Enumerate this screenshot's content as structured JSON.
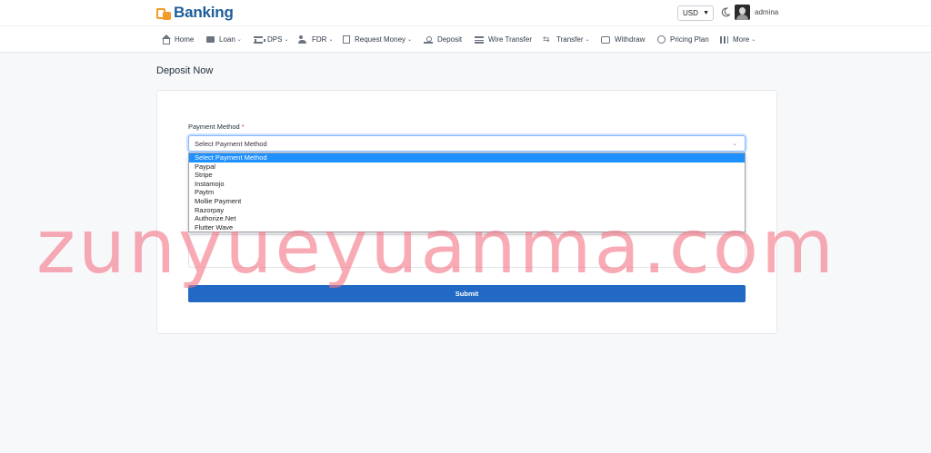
{
  "header": {
    "logo_text": "Banking",
    "currency": "USD",
    "username": "admina"
  },
  "nav": {
    "items": [
      {
        "label": "Home",
        "icon": "home-icon"
      },
      {
        "label": "Loan",
        "icon": "loan-icon",
        "dropdown": true
      },
      {
        "label": "DPS",
        "icon": "bank-icon",
        "dropdown": true
      },
      {
        "label": "FDR",
        "icon": "users-icon",
        "dropdown": true
      },
      {
        "label": "Request Money",
        "icon": "document-icon",
        "dropdown": true
      },
      {
        "label": "Deposit",
        "icon": "hand-coin-icon"
      },
      {
        "label": "Wire Transfer",
        "icon": "lines-icon"
      },
      {
        "label": "Transfer",
        "icon": "arrows-icon",
        "dropdown": true
      },
      {
        "label": "Withdraw",
        "icon": "wallet-icon"
      },
      {
        "label": "Pricing Plan",
        "icon": "tag-icon"
      },
      {
        "label": "More",
        "icon": "grid-icon",
        "dropdown": true
      }
    ]
  },
  "page": {
    "title": "Deposit Now"
  },
  "form": {
    "payment_label": "Payment Method",
    "required_mark": "*",
    "payment_selected": "Select Payment Method",
    "payment_options": [
      "Select Payment Method",
      "Paypal",
      "Stripe",
      "Instamojo",
      "Paytm",
      "Mollie Payment",
      "Razorpay",
      "Authorize.Net",
      "Flutter Wave"
    ],
    "submit_label": "Submit"
  },
  "watermark": "zunyueyuanma.com",
  "colors": {
    "brand": "#1d5d9b",
    "accent": "#2169c4",
    "logo_orange": "#f29b26",
    "watermark": "#f47887"
  }
}
